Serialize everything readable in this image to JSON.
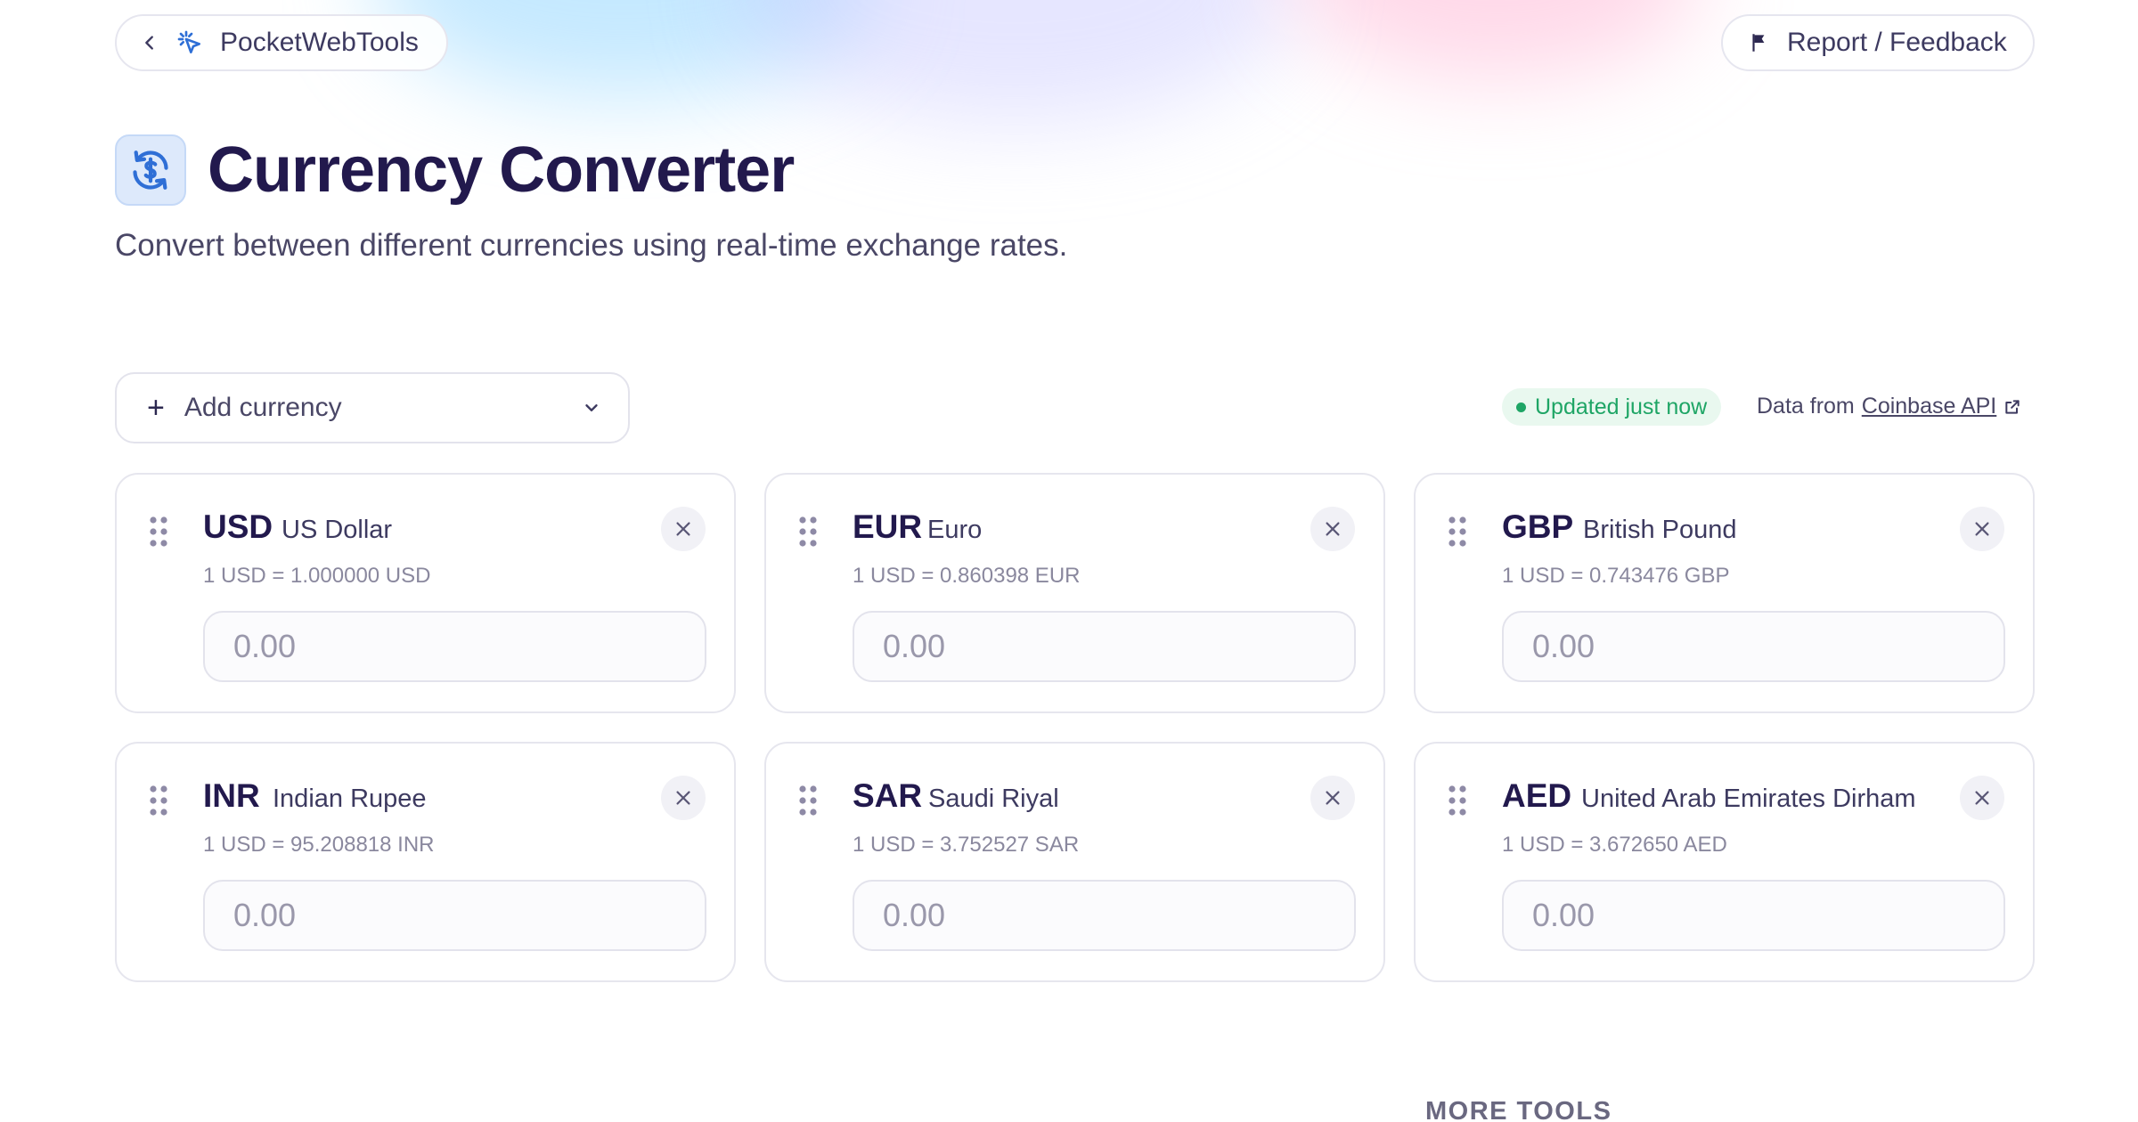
{
  "header": {
    "brand": "PocketWebTools",
    "report_label": "Report / Feedback"
  },
  "main": {
    "title": "Currency Converter",
    "subtitle": "Convert between different currencies using real-time exchange rates."
  },
  "toolbar": {
    "add_currency_label": "Add currency",
    "status": "Updated just now",
    "data_from_prefix": "Data from",
    "data_source": "Coinbase API"
  },
  "currencies": [
    {
      "code": "USD",
      "name": "US Dollar",
      "rate": "1 USD = 1.000000 USD",
      "placeholder": "0.00"
    },
    {
      "code": "EUR",
      "name": "Euro",
      "rate": "1 USD = 0.860398 EUR",
      "placeholder": "0.00"
    },
    {
      "code": "GBP",
      "name": "British Pound",
      "rate": "1 USD = 0.743476 GBP",
      "placeholder": "0.00"
    },
    {
      "code": "INR",
      "name": "Indian Rupee",
      "rate": "1 USD = 95.208818 INR",
      "placeholder": "0.00"
    },
    {
      "code": "SAR",
      "name": "Saudi Riyal",
      "rate": "1 USD = 3.752527 SAR",
      "placeholder": "0.00"
    },
    {
      "code": "AED",
      "name": "United Arab Emirates Dirham",
      "rate": "1 USD = 3.672650 AED",
      "placeholder": "0.00"
    }
  ],
  "footer": {
    "more_tools": "MORE TOOLS"
  },
  "colors": {
    "brand_accent": "#2f6fd6",
    "status_green": "#1ea565",
    "title": "#22194d"
  },
  "icons": {
    "back": "chevron-left-icon",
    "brand": "cursor-click-icon",
    "report": "flag-icon",
    "title": "currency-exchange-icon",
    "add": "plus-icon",
    "dropdown": "chevron-down-icon",
    "external": "external-link-icon",
    "drag": "drag-handle-icon",
    "remove": "close-icon"
  }
}
